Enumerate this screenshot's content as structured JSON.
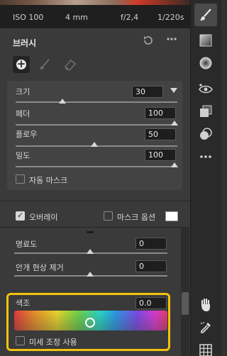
{
  "info_bar": {
    "iso": "ISO 100",
    "focal": "4 mm",
    "aperture": "f/2,4",
    "shutter": "1/220s"
  },
  "brush_panel": {
    "title": "브러시",
    "size": {
      "label": "크기",
      "value": "30"
    },
    "feather": {
      "label": "페더",
      "value": "100"
    },
    "flow": {
      "label": "플로우",
      "value": "50"
    },
    "density": {
      "label": "밀도",
      "value": "100"
    },
    "auto_mask_label": "자동 마스크"
  },
  "overlay_row": {
    "overlay_label": "오버레이",
    "mask_options_label": "마스크 옵션"
  },
  "adjustments": {
    "clarity": {
      "label": "명료도",
      "value": "0"
    },
    "dehaze": {
      "label": "안개 현상 제거",
      "value": "0"
    },
    "hue": {
      "label": "색조",
      "value": "0.0"
    },
    "fine_adjust_label": "미세 조정 사용"
  },
  "colors": {
    "highlight": "#f4c20d",
    "panel": "#3a3a3a",
    "toolbar": "#2a2a2a"
  },
  "icons": {
    "right_toolbar": [
      "brush-icon",
      "gradient-icon",
      "radial-icon",
      "red-eye-icon",
      "layers-icon",
      "color-range-icon",
      "more-icon",
      "hand-icon",
      "eyedropper-icon",
      "grid-icon"
    ],
    "brush_tools": [
      "add-brush-icon",
      "brush-icon",
      "eraser-icon"
    ]
  }
}
